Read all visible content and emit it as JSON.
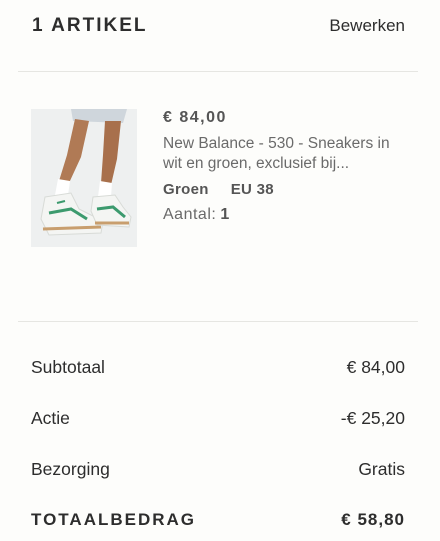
{
  "header": {
    "title": "1 ARTIKEL",
    "edit_label": "Bewerken"
  },
  "item": {
    "price": "€ 84,00",
    "name": "New Balance - 530 - Sneakers in wit en groen, exclusief bij...",
    "color": "Groen",
    "size": "EU 38",
    "quantity_label": "Aantal:",
    "quantity_value": "1"
  },
  "summary": {
    "subtotal_label": "Subtotaal",
    "subtotal_value": "€ 84,00",
    "action_label": "Actie",
    "action_value": "-€ 25,20",
    "shipping_label": "Bezorging",
    "shipping_value": "Gratis",
    "total_label": "TOTAALBEDRAG",
    "total_value": "€ 58,80"
  }
}
